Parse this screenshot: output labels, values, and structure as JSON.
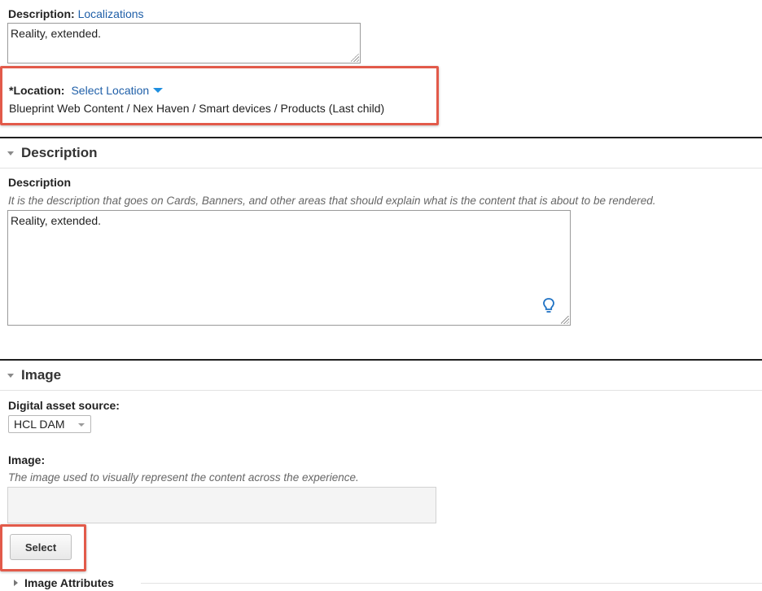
{
  "top": {
    "description_label": "Description:",
    "description_link": "Localizations",
    "description_value": "Reality, extended."
  },
  "location": {
    "label": "*Location:",
    "select_link": "Select Location",
    "path": "Blueprint Web Content / Nex Haven / Smart devices / Products (Last child)"
  },
  "description_section": {
    "title": "Description",
    "field_label": "Description",
    "hint": "It is the description that goes on Cards, Banners, and other areas that should explain what is the content that is about to be rendered.",
    "value": "Reality, extended."
  },
  "image_section": {
    "title": "Image",
    "asset_source_label": "Digital asset source:",
    "asset_source_selected": "HCL DAM",
    "image_label": "Image:",
    "image_hint": "The image used to visually represent the content across the experience.",
    "select_button": "Select",
    "attributes_label": "Image Attributes"
  },
  "icons": {
    "assist": "lightbulb-icon",
    "dropdown": "caret-down-icon"
  },
  "colors": {
    "link": "#1f5fa8",
    "highlight": "#e25a4a"
  }
}
